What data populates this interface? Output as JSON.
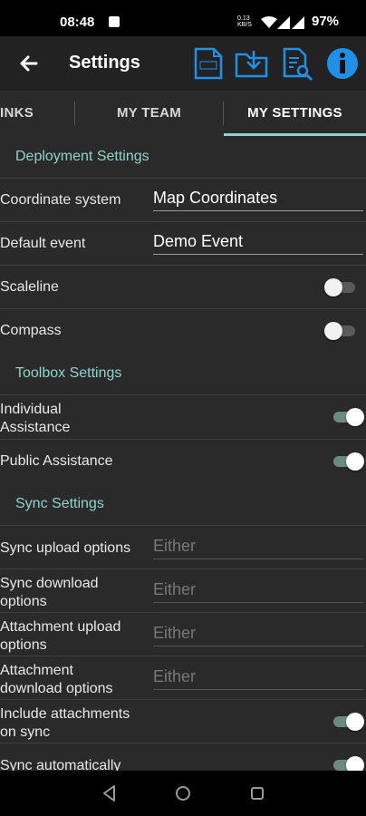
{
  "status": {
    "time": "08:48",
    "speed_top": "0.13",
    "speed_bottom": "KB/S",
    "battery": "97%"
  },
  "app": {
    "title": "Settings"
  },
  "tabs": [
    {
      "label": "INKS"
    },
    {
      "label": "MY TEAM"
    },
    {
      "label": "MY SETTINGS"
    }
  ],
  "sections": {
    "deployment": "Deployment Settings",
    "toolbox": "Toolbox Settings",
    "sync": "Sync Settings"
  },
  "rows": {
    "coordinate_system": {
      "label": "Coordinate system",
      "value": "Map Coordinates"
    },
    "default_event": {
      "label": "Default event",
      "value": "Demo Event"
    },
    "scaleline": {
      "label": "Scaleline",
      "state": "off"
    },
    "compass": {
      "label": "Compass",
      "state": "off"
    },
    "individual_assistance": {
      "label_1": "Individual",
      "label_2": "Assistance",
      "state": "on"
    },
    "public_assistance": {
      "label": "Public Assistance",
      "state": "on"
    },
    "sync_upload": {
      "label": "Sync upload options",
      "value": "Either"
    },
    "sync_download": {
      "label_1": "Sync download",
      "label_2": "options",
      "value": "Either"
    },
    "attachment_upload": {
      "label_1": "Attachment upload",
      "label_2": "options",
      "value": "Either"
    },
    "attachment_download": {
      "label_1": "Attachment",
      "label_2": "download options",
      "value": "Either"
    },
    "include_attachments": {
      "label_1": "Include attachments",
      "label_2": "on sync",
      "state": "on"
    },
    "sync_automatically": {
      "label": "Sync automatically",
      "state": "on"
    }
  },
  "colors": {
    "accent": "#8fd3c9",
    "icon_blue": "#1e90e8",
    "background": "#2a2a2a"
  },
  "icons": [
    "back-arrow-icon",
    "log-file-icon",
    "download-folder-icon",
    "search-document-icon",
    "info-icon"
  ]
}
